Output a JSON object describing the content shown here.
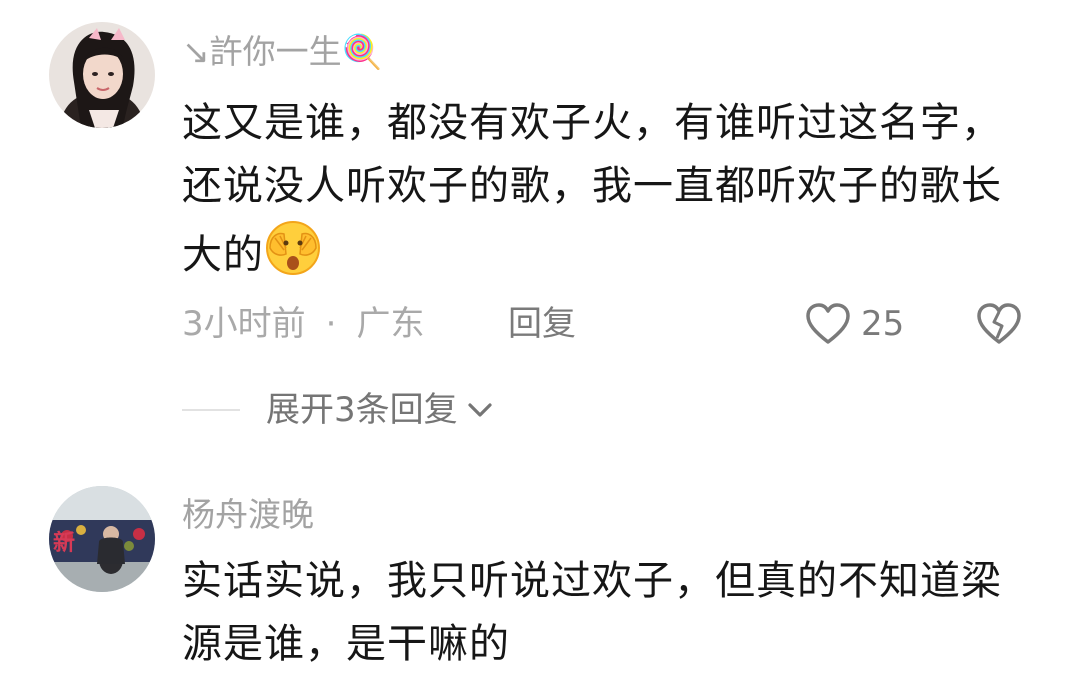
{
  "comments": [
    {
      "username": "↘許你一生🍭",
      "text": "这又是谁，都没有欢子火，有谁听过这名字，还说没人听欢子的歌，我一直都听欢子的歌长大的",
      "emoji_icon": "face-with-hands-over-eyes-icon",
      "time": "3小时前",
      "separator": "·",
      "location": "广东",
      "reply_label": "回复",
      "likes": "25",
      "expand_label": "展开3条回复"
    },
    {
      "username": "杨舟渡晚",
      "text": "实话实说，我只听说过欢子，但真的不知道梁源是谁，是干嘛的"
    }
  ],
  "icons": {
    "like": "heart-outline-icon",
    "dislike": "broken-heart-icon",
    "expand": "chevron-down-icon"
  },
  "colors": {
    "text": "#161616",
    "muted": "#a3a3a3",
    "action": "#7a7a7a"
  }
}
